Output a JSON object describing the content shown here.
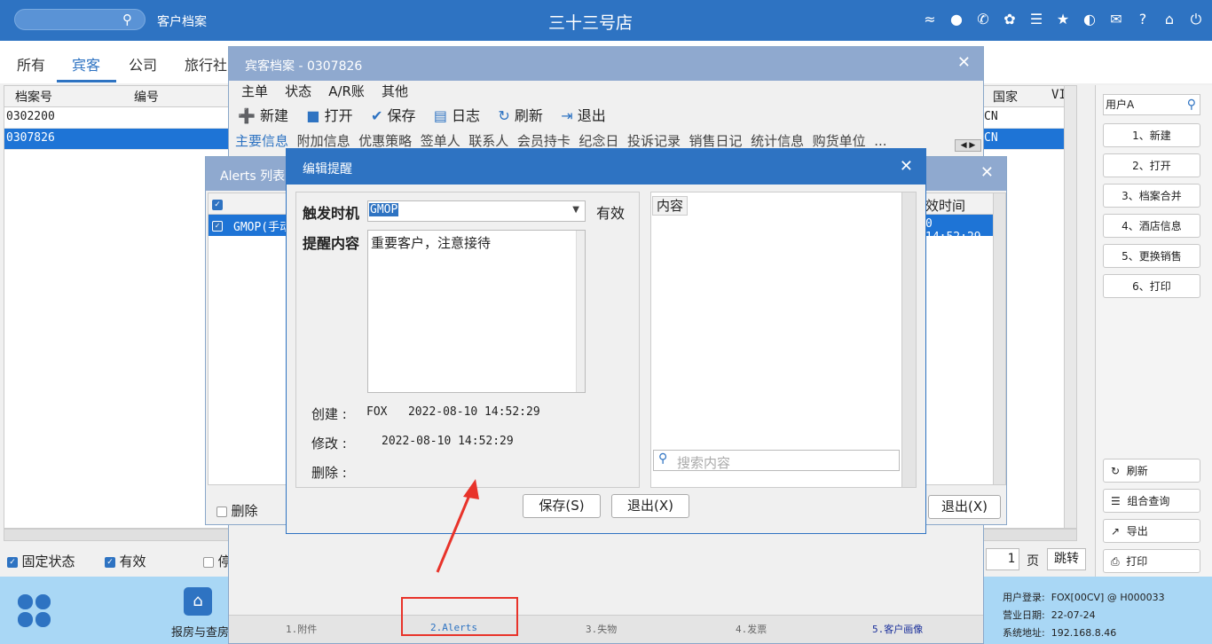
{
  "topbar": {
    "search_placeholder": "",
    "module_title": "客户档案",
    "store_name": "三十三号店"
  },
  "cat_tabs": [
    "所有",
    "宾客",
    "公司",
    "旅行社"
  ],
  "main_grid": {
    "headers": {
      "archive_no": "档案号",
      "code": "编号",
      "country": "国家",
      "vip": "VIP"
    },
    "rows": [
      {
        "archive_no": "0302200",
        "country": "CN"
      },
      {
        "archive_no": "0307826",
        "country": "CN"
      }
    ]
  },
  "right_panel": {
    "user_search": "用户A",
    "buttons": [
      "1、新建",
      "2、打开",
      "3、档案合并",
      "4、酒店信息",
      "5、更换销售",
      "6、打印"
    ],
    "bottom_buttons": [
      "刷新",
      "组合查询",
      "导出",
      "打印"
    ]
  },
  "status_strip": {
    "fixed_state": "固定状态",
    "valid": "有效",
    "stop": "停",
    "page_num": "1",
    "page_label": "页",
    "jump": "跳转"
  },
  "bottombar": {
    "app_label": "报房与查房",
    "user_login_label": "用户登录:",
    "user_login": "FOX[00CV] @ H000033",
    "biz_date_label": "营业日期:",
    "biz_date": "22-07-24",
    "sys_addr_label": "系统地址:",
    "sys_addr": "192.168.8.46"
  },
  "guest_dialog": {
    "title": "宾客档案 - 0307826",
    "menu": [
      "主单",
      "状态",
      "A/R账",
      "其他"
    ],
    "toolbar": {
      "new": "新建",
      "open": "打开",
      "save": "保存",
      "log": "日志",
      "refresh": "刷新",
      "exit": "退出"
    },
    "subtabs": [
      "主要信息",
      "附加信息",
      "优惠策略",
      "签单人",
      "联系人",
      "会员持卡",
      "纪念日",
      "投诉记录",
      "销售日记",
      "统计信息",
      "购货单位",
      "..."
    ],
    "bottom_tabs": [
      "1.附件",
      "2.Alerts",
      "3.失物",
      "4.发票",
      "5.客户画像"
    ]
  },
  "alerts_dialog": {
    "title": "Alerts 列表",
    "row_text": "GMOP(手动",
    "time_header": "效时间",
    "row_time": "0 14:52:29",
    "delete_label": "删除",
    "exit": "退出(X)"
  },
  "edit_dialog": {
    "title": "编辑提醒",
    "trigger_label": "触发时机",
    "trigger_value": "GMOP",
    "valid_label": "有效",
    "content_label": "提醒内容",
    "content_value": "重要客户，注意接待",
    "created_label": "创建 :",
    "created_value": "FOX   2022-08-10 14:52:29",
    "modified_label": "修改 :",
    "modified_value": "2022-08-10 14:52:29",
    "deleted_label": "删除 :",
    "list_header": "内容",
    "search_placeholder": "搜索内容",
    "save": "保存(S)",
    "exit": "退出(X)"
  },
  "colors": {
    "primary": "#2e73c2",
    "selection": "#1e74d6",
    "bottom": "#a9d7f5",
    "annotation": "#e8332a"
  }
}
